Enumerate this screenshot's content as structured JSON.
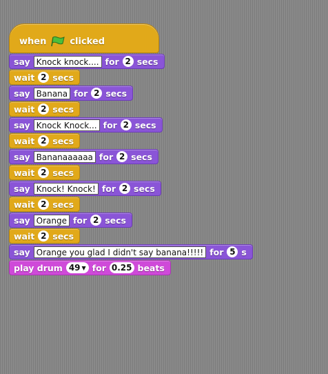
{
  "hat": {
    "when": "when",
    "clicked": "clicked"
  },
  "blocks": [
    {
      "kind": "say",
      "label": "say",
      "text": "Knock knock....",
      "for": "for",
      "secs_value": "2",
      "secs": "secs"
    },
    {
      "kind": "wait",
      "label": "wait",
      "value": "2",
      "secs": "secs"
    },
    {
      "kind": "say",
      "label": "say",
      "text": "Banana",
      "for": "for",
      "secs_value": "2",
      "secs": "secs"
    },
    {
      "kind": "wait",
      "label": "wait",
      "value": "2",
      "secs": "secs"
    },
    {
      "kind": "say",
      "label": "say",
      "text": "Knock Knock...",
      "for": "for",
      "secs_value": "2",
      "secs": "secs"
    },
    {
      "kind": "wait",
      "label": "wait",
      "value": "2",
      "secs": "secs"
    },
    {
      "kind": "say",
      "label": "say",
      "text": "Bananaaaaaa",
      "for": "for",
      "secs_value": "2",
      "secs": "secs"
    },
    {
      "kind": "wait",
      "label": "wait",
      "value": "2",
      "secs": "secs"
    },
    {
      "kind": "say",
      "label": "say",
      "text": "Knock! Knock!",
      "for": "for",
      "secs_value": "2",
      "secs": "secs"
    },
    {
      "kind": "wait",
      "label": "wait",
      "value": "2",
      "secs": "secs"
    },
    {
      "kind": "say",
      "label": "say",
      "text": "Orange",
      "for": "for",
      "secs_value": "2",
      "secs": "secs"
    },
    {
      "kind": "wait",
      "label": "wait",
      "value": "2",
      "secs": "secs"
    },
    {
      "kind": "say",
      "label": "say",
      "text": "Orange you glad I didn't say banana!!!!!",
      "for": "for",
      "secs_value": "5",
      "secs": "s"
    }
  ],
  "drum": {
    "label": "play drum",
    "drum_value": "49",
    "for": "for",
    "beats_value": "0.25",
    "beats": "beats"
  },
  "colors": {
    "looks": "#8a55d7",
    "control": "#e1a91a",
    "sound": "#cf4ad9",
    "flag": "#4cbf3b"
  },
  "icons": {
    "flag": "green-flag-icon",
    "dropdown": "dropdown-triangle-icon"
  }
}
